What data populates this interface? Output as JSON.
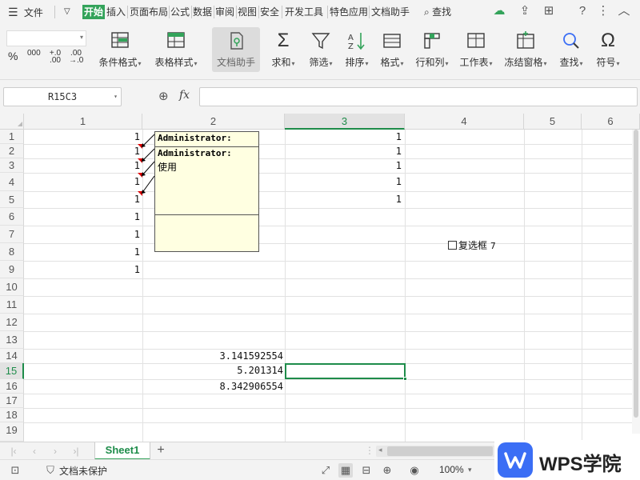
{
  "menubar": {
    "file_label": "文件",
    "tabs": [
      "开始",
      "插入",
      "页面布局",
      "公式",
      "数据",
      "审阅",
      "视图",
      "安全",
      "开发工具",
      "特色应用",
      "文档助手"
    ],
    "search_label": "查找"
  },
  "ribbon": {
    "buttons": [
      {
        "label": "条件格式",
        "icon": "conditional-format-icon"
      },
      {
        "label": "表格样式",
        "icon": "table-style-icon"
      },
      {
        "label": "文档助手",
        "icon": "doc-assistant-icon"
      },
      {
        "label": "求和",
        "icon": "sum-icon"
      },
      {
        "label": "筛选",
        "icon": "filter-icon"
      },
      {
        "label": "排序",
        "icon": "sort-icon"
      },
      {
        "label": "格式",
        "icon": "format-icon"
      },
      {
        "label": "行和列",
        "icon": "rows-cols-icon"
      },
      {
        "label": "工作表",
        "icon": "worksheet-icon"
      },
      {
        "label": "冻结窗格",
        "icon": "freeze-panes-icon"
      },
      {
        "label": "查找",
        "icon": "find-icon"
      },
      {
        "label": "符号",
        "icon": "symbol-icon"
      }
    ],
    "numfmt": [
      "%",
      "000",
      "+.0 .00",
      ".00 →.0"
    ]
  },
  "formula_bar": {
    "name_box": "R15C3",
    "fx": "fx",
    "formula": ""
  },
  "grid": {
    "columns": [
      "1",
      "2",
      "3",
      "4",
      "5",
      "6"
    ],
    "selected_column": "3",
    "rows": [
      "1",
      "2",
      "3",
      "4",
      "5",
      "6",
      "7",
      "8",
      "9",
      "10",
      "11",
      "12",
      "13",
      "14",
      "15",
      "16",
      "17",
      "18",
      "19"
    ],
    "selected_row": "15",
    "col1_values": [
      "1",
      "1",
      "1",
      "1",
      "1",
      "1",
      "1",
      "1",
      "1"
    ],
    "col3_values": [
      "1",
      "1",
      "1",
      "1",
      "1"
    ],
    "col2_values": {
      "r14": "3.141592554",
      "r15": "5.201314",
      "r16": "8.342906554"
    }
  },
  "comments": [
    {
      "author": "Administrator:",
      "text": ""
    },
    {
      "author": "Administrator:",
      "text": "使用"
    }
  ],
  "checkbox": {
    "label": "复选框",
    "number": "7"
  },
  "sheet_tabs": {
    "active": "Sheet1",
    "add": "+"
  },
  "statusbar": {
    "protect_label": "文档未保护",
    "zoom": "100%",
    "zoom_caret": "▾"
  },
  "watermark": {
    "brand": "WPS学院"
  },
  "colors": {
    "accent": "#33a35a",
    "selection": "#1e8c4a",
    "comment_bg": "#ffffe1",
    "logo": "#3b6ef5"
  }
}
